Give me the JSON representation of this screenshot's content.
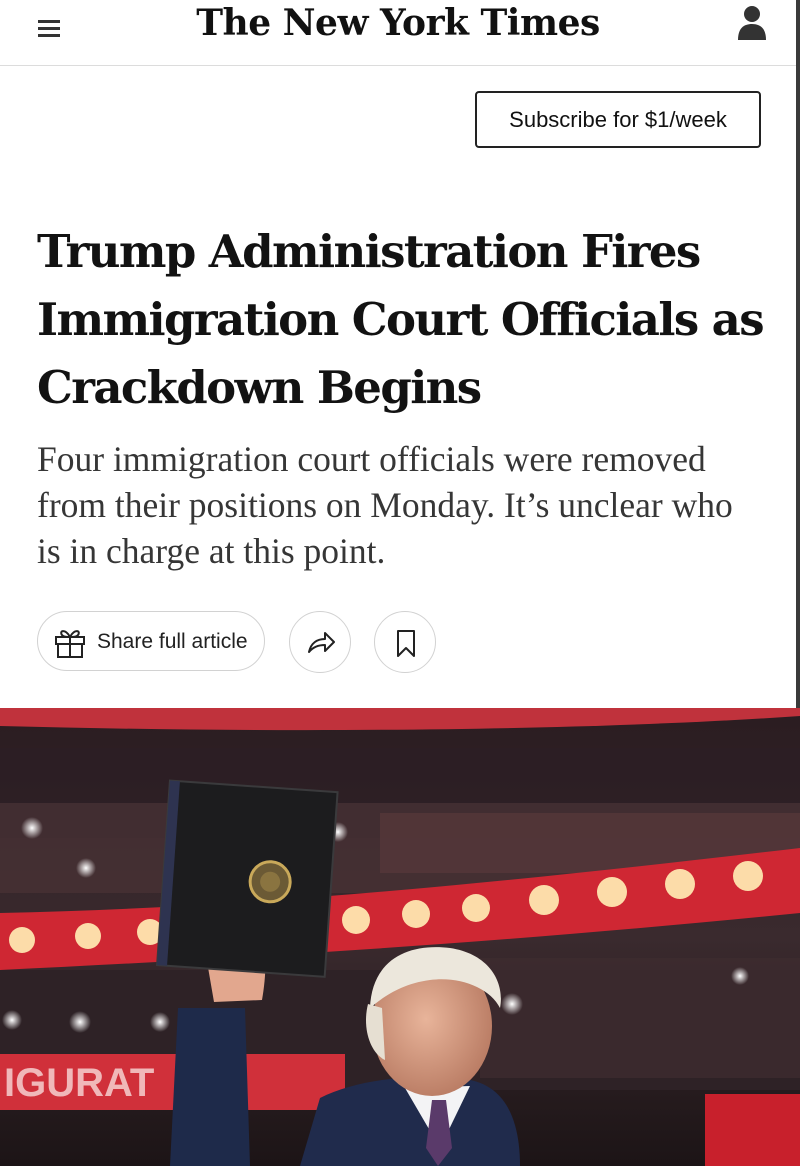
{
  "header": {
    "masthead": "The New York Times",
    "menu_icon": "hamburger-menu-icon",
    "account_icon": "user-account-icon"
  },
  "subscribe": {
    "label": "Subscribe for $1/week"
  },
  "article": {
    "headline_lines": [
      "Trump Administration Fires",
      "Immigration Court Officials as",
      "Crackdown Begins"
    ],
    "summary_lines": [
      "Four immigration court officials were removed",
      "from their positions on Monday. It’s unclear who",
      "is in charge at this point."
    ]
  },
  "actions": {
    "share_label": "Share full article",
    "share_icon": "gift-icon",
    "forward_icon": "share-arrow-icon",
    "save_icon": "bookmark-icon"
  },
  "hero_image": {
    "banner_text": "IGURAT"
  },
  "colors": {
    "text": "#121212",
    "summary_text": "#363636",
    "border": "#d2d2d2",
    "stage_red": "#c81e2a"
  }
}
